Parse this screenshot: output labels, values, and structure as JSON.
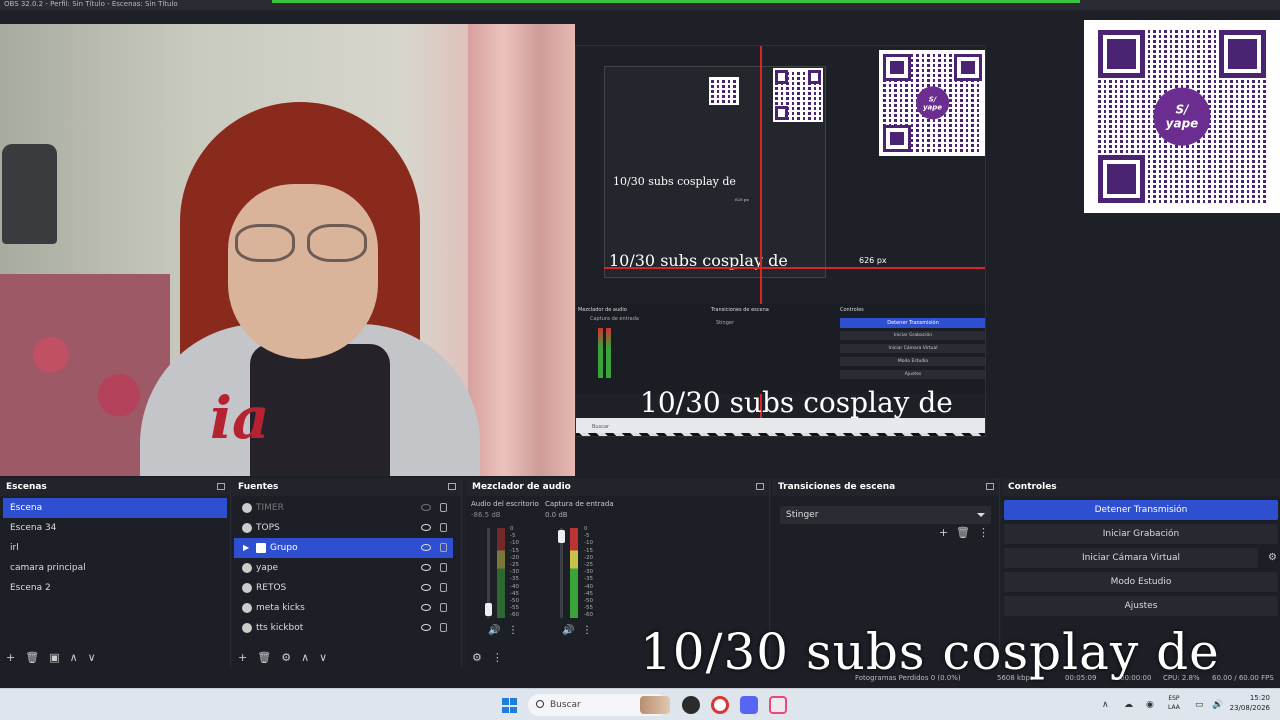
{
  "window": {
    "title": "OBS 32.0.2 - Perfil: Sin Título - Escenas: Sin Título"
  },
  "preview": {
    "banner_small_1": "10/30 subs cosplay de",
    "banner_small_2": "10/30 subs cosplay de",
    "banner_mid": "10/30 subs cosplay de",
    "banner_nested": "10/30 subs cosplay de",
    "px_label_1": "626 px",
    "px_label_2": "626 px",
    "qr_badge_symbol": "S/",
    "qr_badge_text": "yape",
    "nested_panel_titles": [
      "Mezclador de audio",
      "Transiciones de escena",
      "Controles"
    ],
    "nested_buttons": [
      "Detener Transmisión",
      "Iniciar Grabación",
      "Iniciar Cámara Virtual",
      "Modo Estudio",
      "Ajustes"
    ],
    "nested_stinger": "Stinger",
    "nested_capture": "Captura de entrada",
    "nested_search": "Buscar"
  },
  "scenes": {
    "title": "Escenas",
    "items": [
      "Escena",
      "Escena 34",
      "irl",
      "camara principal",
      "Escena 2"
    ],
    "selected": 0
  },
  "sources": {
    "title": "Fuentes",
    "items": [
      {
        "label": "TIMER",
        "icon": "timer-icon",
        "hidden": true
      },
      {
        "label": "TOPS",
        "icon": "image-icon"
      },
      {
        "label": "Grupo",
        "icon": "folder-icon",
        "selected": true
      },
      {
        "label": "yape",
        "icon": "image-icon"
      },
      {
        "label": "RETOS",
        "icon": "image-icon"
      },
      {
        "label": "meta kicks",
        "icon": "browser-icon"
      },
      {
        "label": "tts kickbot",
        "icon": "browser-icon"
      }
    ]
  },
  "mixer": {
    "title": "Mezclador de audio",
    "channels": [
      {
        "name": "Audio del escritorio",
        "db": "-86.5 dB",
        "level": 0.1
      },
      {
        "name": "Captura de entrada",
        "db": "0.0 dB",
        "level": 1.0
      }
    ],
    "scale": [
      "0",
      "-5",
      "-10",
      "-15",
      "-20",
      "-25",
      "-30",
      "-35",
      "-40",
      "-45",
      "-50",
      "-55",
      "-60"
    ]
  },
  "transitions": {
    "title": "Transiciones de escena",
    "selected": "Stinger"
  },
  "controls": {
    "title": "Controles",
    "buttons": [
      "Detener Transmisión",
      "Iniciar Grabación",
      "Iniciar Cámara Virtual",
      "Modo Estudio",
      "Ajustes"
    ]
  },
  "overlay_banner": "10/30 subs cosplay de",
  "status": {
    "dropped": "Fotogramas Perdidos 0 (0.0%)",
    "bitrate": "5608 kbps",
    "stream_time": "00:05:09",
    "rec_time": "00:00:00",
    "cpu": "CPU: 2.8%",
    "fps": "60.00 / 60.00 FPS"
  },
  "taskbar": {
    "search_placeholder": "Buscar",
    "lang_top": "ESP",
    "lang_bottom": "LAA",
    "time": "15:20",
    "date": "23/08/2026"
  },
  "colors": {
    "accent": "#2f4fd1",
    "yape": "#4b2373",
    "live_red": "#d9242a"
  }
}
